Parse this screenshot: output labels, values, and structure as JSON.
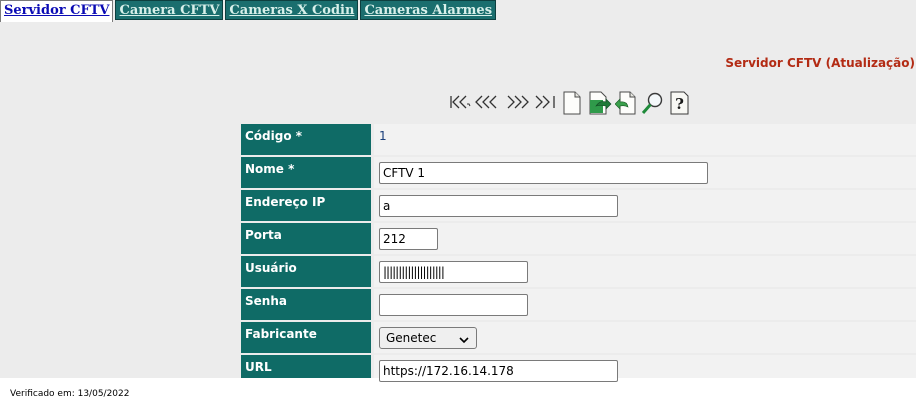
{
  "tabs": [
    {
      "label": "Servidor CFTV",
      "active": true
    },
    {
      "label": "Camera CFTV",
      "active": false
    },
    {
      "label": "Cameras X Codin",
      "active": false
    },
    {
      "label": "Cameras Alarmes",
      "active": false
    }
  ],
  "page_title": "Servidor CFTV (Atualização)",
  "toolbar": {
    "icons": [
      "first-record-icon",
      "previous-record-icon",
      "next-record-icon",
      "last-record-icon",
      "new-document-icon",
      "save-document-icon",
      "undo-document-icon",
      "search-icon",
      "help-icon"
    ]
  },
  "form": {
    "codigo": {
      "label": "Código *",
      "value": "1"
    },
    "nome": {
      "label": "Nome *",
      "value": "CFTV 1"
    },
    "endereco_ip": {
      "label": "Endereço IP",
      "value": "a"
    },
    "porta": {
      "label": "Porta",
      "value": "212"
    },
    "usuario": {
      "label": "Usuário",
      "value": "||||||||||||||||||||"
    },
    "senha": {
      "label": "Senha",
      "value": ""
    },
    "fabricante": {
      "label": "Fabricante",
      "value": "Genetec"
    },
    "url": {
      "label": "URL",
      "value": "https://172.16.14.178"
    }
  },
  "footer": {
    "text": "Verificado em: 13/05/2022"
  },
  "colors": {
    "label_bg": "#0f6b66",
    "tab_inactive_bg": "#1a6e6e",
    "title": "#b32b14",
    "page_bg": "#ececec"
  }
}
